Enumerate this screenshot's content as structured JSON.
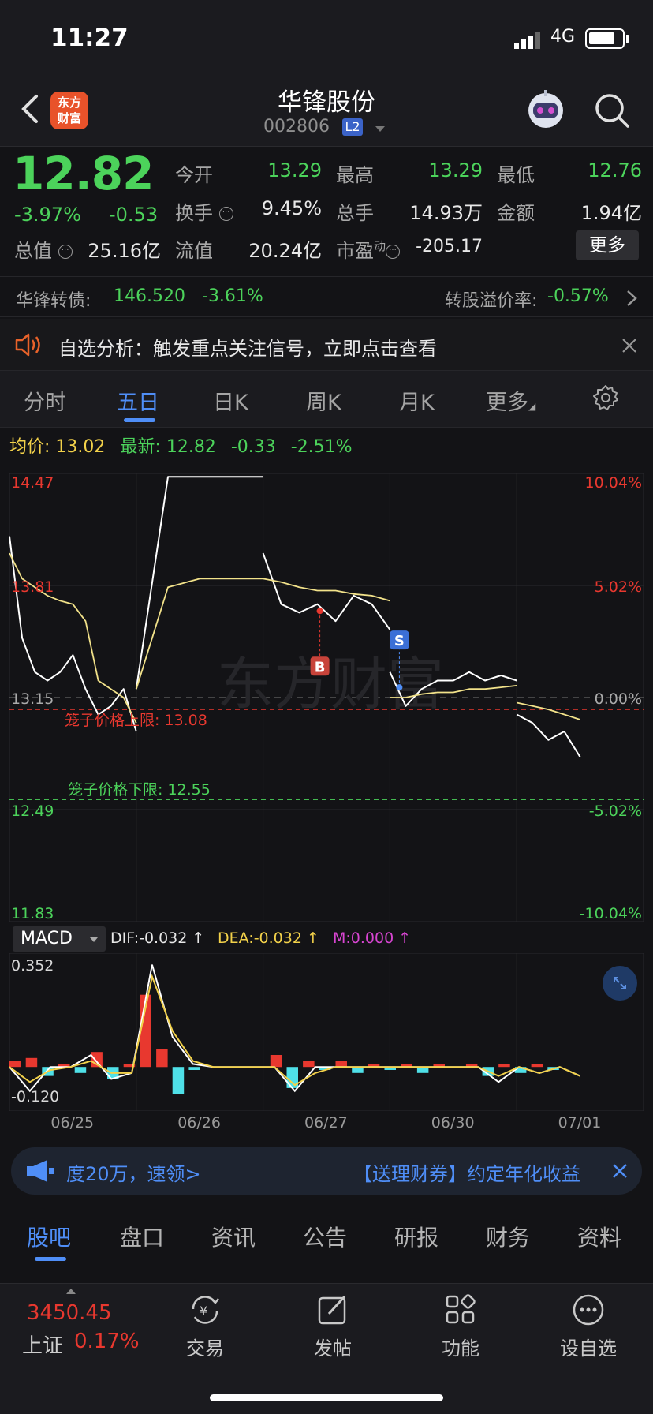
{
  "status_bar": {
    "time": "11:27",
    "network": "4G"
  },
  "header": {
    "app_logo": "东方\n财富",
    "stock_name": "华锋股份",
    "stock_code": "002806",
    "level_badge": "L2"
  },
  "quote": {
    "price": "12.82",
    "change_pct": "-3.97%",
    "change_abs": "-0.53",
    "fields": [
      {
        "label": "今开",
        "value": "13.29",
        "color": "green"
      },
      {
        "label": "最高",
        "value": "13.29",
        "color": "green"
      },
      {
        "label": "最低",
        "value": "12.76",
        "color": "green"
      },
      {
        "label": "换手",
        "value": "9.45%",
        "color": "white"
      },
      {
        "label": "总手",
        "value": "14.93万",
        "color": "white"
      },
      {
        "label": "金额",
        "value": "1.94亿",
        "color": "white"
      },
      {
        "label": "总值",
        "value": "25.16亿",
        "color": "white"
      },
      {
        "label": "流值",
        "value": "20.24亿",
        "color": "white"
      },
      {
        "label": "市盈",
        "value": "-205.17",
        "color": "white"
      }
    ],
    "pe_suffix": "动",
    "more_label": "更多"
  },
  "bond": {
    "name": "华锋转债:",
    "price": "146.520",
    "change": "-3.61%",
    "premium_label": "转股溢价率:",
    "premium_value": "-0.57%"
  },
  "alert": {
    "text": "自选分析：触发重点关注信号，立即点击查看"
  },
  "chart_tabs": [
    "分时",
    "五日",
    "日K",
    "周K",
    "月K",
    "更多"
  ],
  "active_chart_tab": 1,
  "legend": {
    "avg_label": "均价:",
    "avg_value": "13.02",
    "latest_label": "最新:",
    "latest_value": "12.82",
    "change_abs": "-0.33",
    "change_pct": "-2.51%"
  },
  "chart_data": [
    {
      "type": "line",
      "x": [
        "06/25",
        "06/26",
        "06/27",
        "06/30",
        "07/01"
      ],
      "y_ticks_left": [
        "14.47",
        "13.81",
        "13.15",
        "12.49",
        "11.83"
      ],
      "y_ticks_right": [
        "10.04%",
        "5.02%",
        "0.00%",
        "-5.02%",
        "-10.04%"
      ],
      "ylim": [
        11.83,
        14.47
      ],
      "prev_close": 13.15,
      "series": [
        {
          "color": "#ffffff",
          "values": [
            14.1,
            13.5,
            13.3,
            13.25,
            13.3,
            13.4,
            13.2,
            13.05,
            13.1,
            13.2,
            12.95,
            13.2,
            14.45,
            14.45,
            14.45,
            14.45,
            14.0,
            13.7,
            13.65,
            13.7,
            13.6,
            13.75,
            13.7,
            13.55,
            13.3,
            13.1,
            13.2,
            13.25,
            13.25,
            13.3,
            13.25,
            13.28,
            13.25,
            13.05,
            13.0,
            12.9,
            12.95,
            12.8
          ]
        },
        {
          "color": "#f2e28a",
          "values": [
            14.0,
            13.85,
            13.8,
            13.75,
            13.72,
            13.7,
            13.6,
            13.25,
            13.2,
            13.15,
            13.0,
            13.2,
            13.8,
            13.85,
            13.85,
            13.85,
            13.85,
            13.83,
            13.8,
            13.78,
            13.78,
            13.76,
            13.75,
            13.72,
            13.15,
            13.15,
            13.17,
            13.18,
            13.18,
            13.2,
            13.2,
            13.21,
            13.22,
            13.12,
            13.1,
            13.08,
            13.05,
            13.02
          ]
        }
      ],
      "annotations": [
        {
          "text": "笼子价格上限: 13.08",
          "value": 13.08,
          "color": "#e8382f"
        },
        {
          "text": "笼子价格下限: 12.55",
          "value": 12.55,
          "color": "#4cd35b"
        }
      ],
      "markers": [
        {
          "label": "B",
          "day": 2,
          "value": 13.66
        },
        {
          "label": "S",
          "day": 3,
          "value": 13.21
        }
      ]
    },
    {
      "type": "bar",
      "name": "MACD",
      "ylim": [
        -0.12,
        0.352
      ],
      "y_ticks": [
        "0.352",
        "-0.120"
      ],
      "dif_label": "DIF:-0.032 ↑",
      "dea_label": "DEA:-0.032 ↑",
      "m_label": "M:0.000 ↑",
      "histogram": [
        0.02,
        0.03,
        -0.03,
        0.01,
        -0.02,
        0.05,
        -0.04,
        0.01,
        0.24,
        0.06,
        -0.09,
        -0.01,
        0.0,
        0.0,
        0.0,
        0.0,
        0.04,
        -0.07,
        0.02,
        -0.01,
        0.02,
        -0.02,
        0.01,
        -0.01,
        0.01,
        -0.02,
        0.01,
        0.0,
        0.01,
        -0.03,
        0.01,
        -0.02,
        0.01,
        -0.01,
        0.0
      ],
      "dif": [
        0.0,
        -0.08,
        0.0,
        0.0,
        0.04,
        -0.04,
        -0.02,
        0.34,
        0.1,
        0.01,
        0.0,
        0.0,
        0.0,
        0.0,
        -0.08,
        0.0,
        0.0,
        0.0,
        0.0,
        0.0,
        0.0,
        0.0,
        0.0,
        0.0,
        -0.05,
        0.0,
        -0.02,
        0.0,
        -0.03
      ],
      "dea": [
        0.0,
        -0.05,
        -0.01,
        0.0,
        0.02,
        -0.02,
        -0.02,
        0.3,
        0.12,
        0.02,
        0.0,
        0.0,
        0.0,
        0.0,
        -0.06,
        -0.02,
        0.0,
        0.0,
        0.0,
        0.0,
        0.0,
        0.0,
        0.0,
        0.0,
        -0.03,
        0.0,
        -0.02,
        0.0,
        -0.03
      ]
    }
  ],
  "promo": {
    "text_1": "度20万，速领>",
    "text_2": "【送理财券】约定年化收益"
  },
  "info_tabs": [
    "股吧",
    "盘口",
    "资讯",
    "公告",
    "研报",
    "财务",
    "资料"
  ],
  "active_info_tab": 0,
  "bottom_nav": {
    "index_value": "3450.45",
    "index_name": "上证",
    "index_pct": "0.17%",
    "items": [
      "交易",
      "发帖",
      "功能",
      "设自选"
    ]
  },
  "colors": {
    "rise": "#e8382f",
    "fall": "#4cd35b",
    "accent": "#4f8ef7",
    "avg_line": "#f2e28a",
    "background": "#131316"
  }
}
